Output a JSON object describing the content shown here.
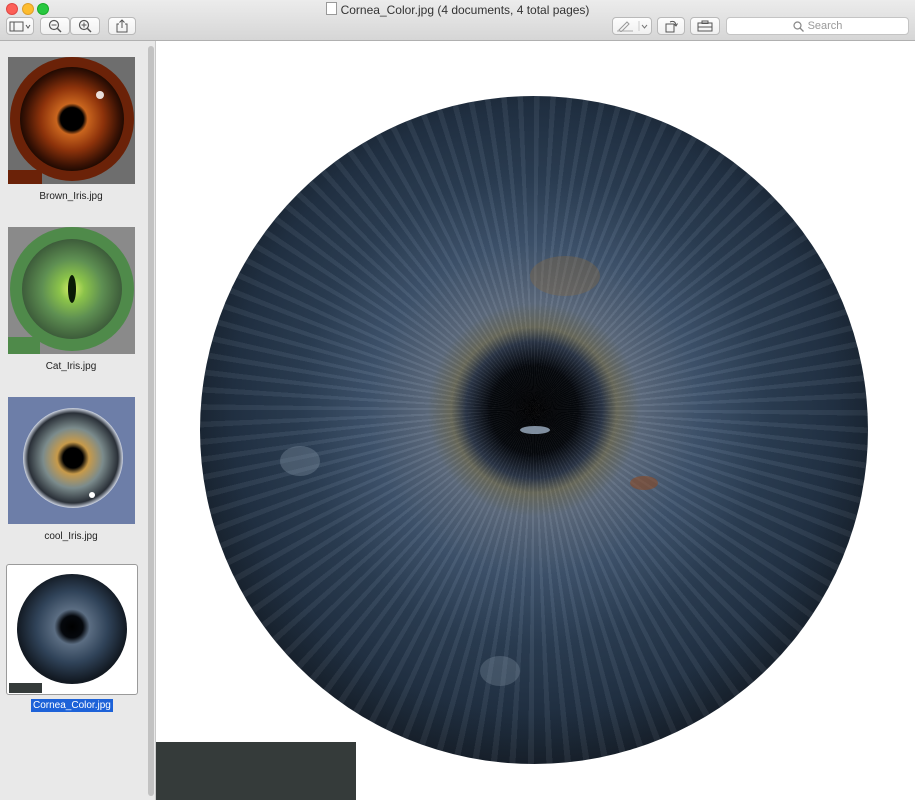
{
  "window": {
    "title": "Cornea_Color.jpg (4 documents, 4 total pages)",
    "buttons": [
      {
        "name": "sidebar-toggle-button",
        "icon": "sidebar-icon"
      },
      {
        "name": "zoom-out-button",
        "icon": "zoom-out-icon"
      },
      {
        "name": "zoom-in-button",
        "icon": "zoom-in-icon"
      },
      {
        "name": "share-button",
        "icon": "share-icon"
      },
      {
        "name": "markup-button",
        "icon": "pen-icon"
      },
      {
        "name": "rotate-button",
        "icon": "rotate-icon"
      },
      {
        "name": "toolbox-button",
        "icon": "toolbox-icon"
      }
    ],
    "search_placeholder": "Search"
  },
  "sidebar": {
    "items": [
      {
        "label": "Brown_Iris.jpg",
        "selected": false
      },
      {
        "label": "Cat_Iris.jpg",
        "selected": false
      },
      {
        "label": "cool_Iris.jpg",
        "selected": false
      },
      {
        "label": "Cornea_Color.jpg",
        "selected": true
      }
    ]
  },
  "colors": {
    "selection": "#1d62d8",
    "brown_iris": "#8b3a10",
    "cat_iris": "#4f8a4a",
    "cool_bg": "#6d7ea8"
  }
}
